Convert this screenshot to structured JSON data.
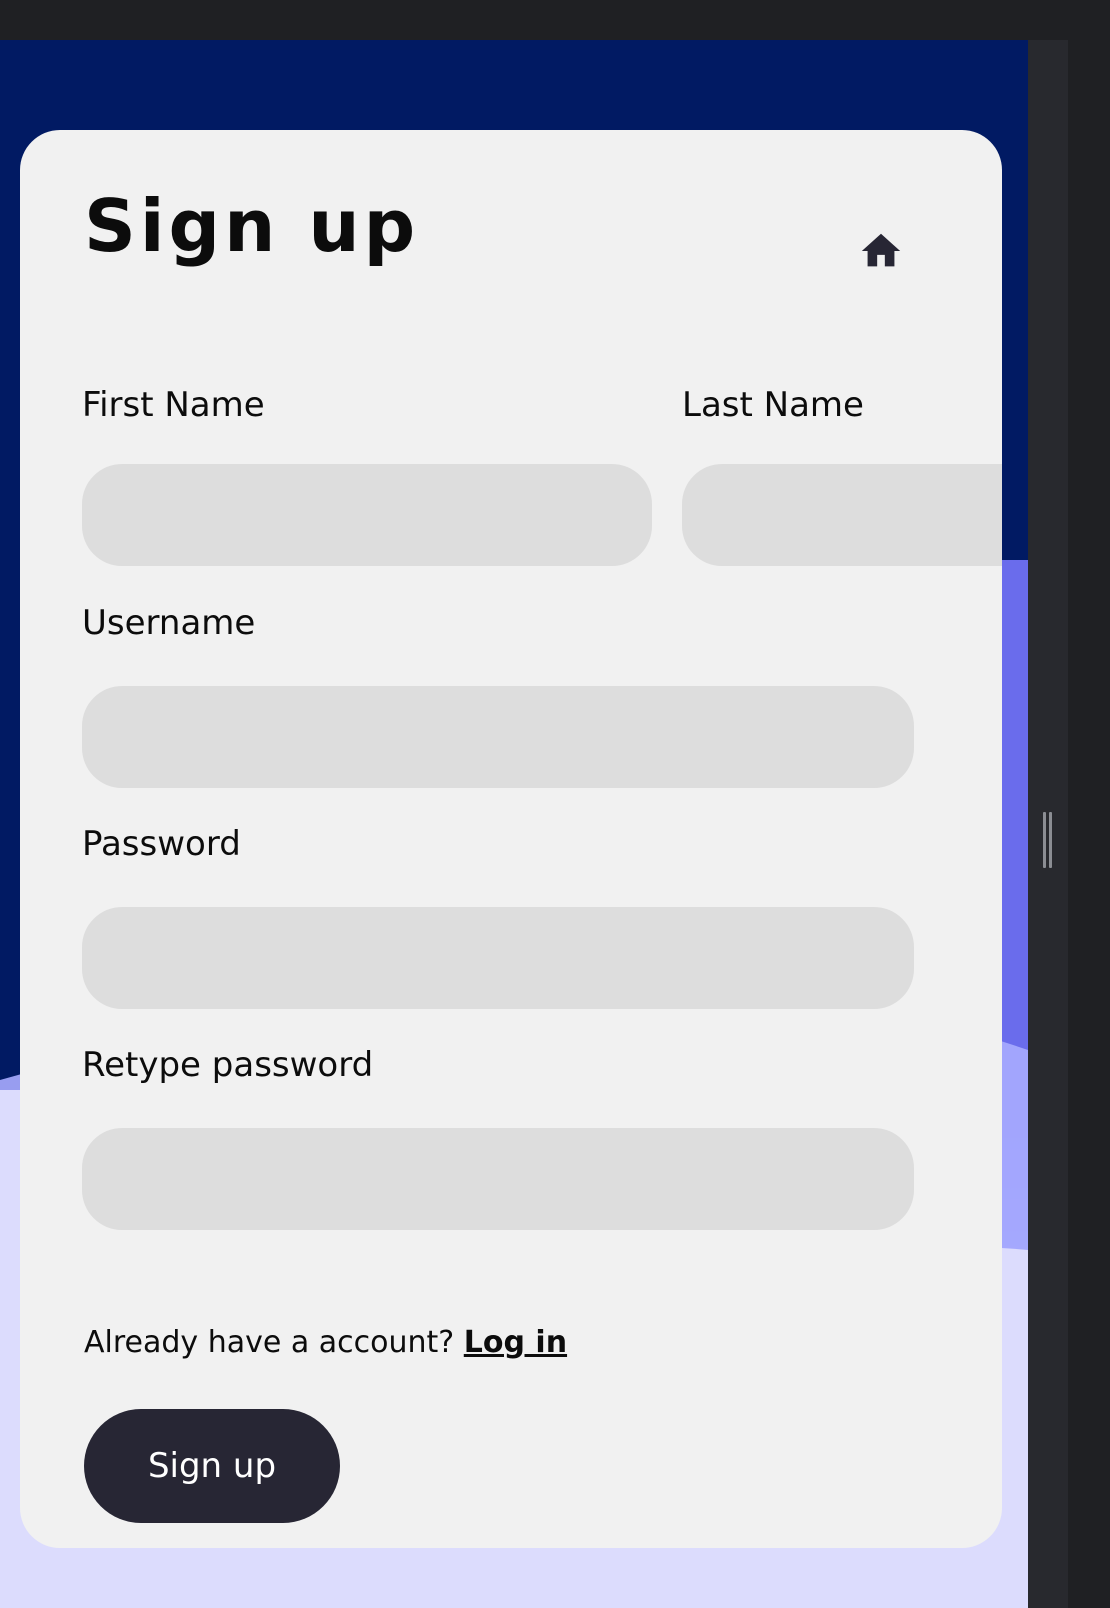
{
  "page": {
    "title": "Sign up"
  },
  "icons": {
    "home": "home-icon"
  },
  "form": {
    "first_name": {
      "label": "First Name",
      "value": "",
      "placeholder": ""
    },
    "last_name": {
      "label": "Last Name",
      "value": "",
      "placeholder": ""
    },
    "username": {
      "label": "Username",
      "value": "",
      "placeholder": ""
    },
    "password": {
      "label": "Password",
      "value": "",
      "placeholder": ""
    },
    "retype_password": {
      "label": "Retype password",
      "value": "",
      "placeholder": ""
    }
  },
  "login_prompt": {
    "text": "Already have a account?",
    "link_label": "Log in"
  },
  "submit_label": "Sign up",
  "colors": {
    "background_top": "#011a63",
    "wave_mid": "#6a6cec",
    "wave_light": "#a8acff",
    "background_bottom": "#dcdcfd",
    "card": "#f1f1f1",
    "input": "#dddddd",
    "button": "#272634",
    "text": "#0c0c0c"
  }
}
